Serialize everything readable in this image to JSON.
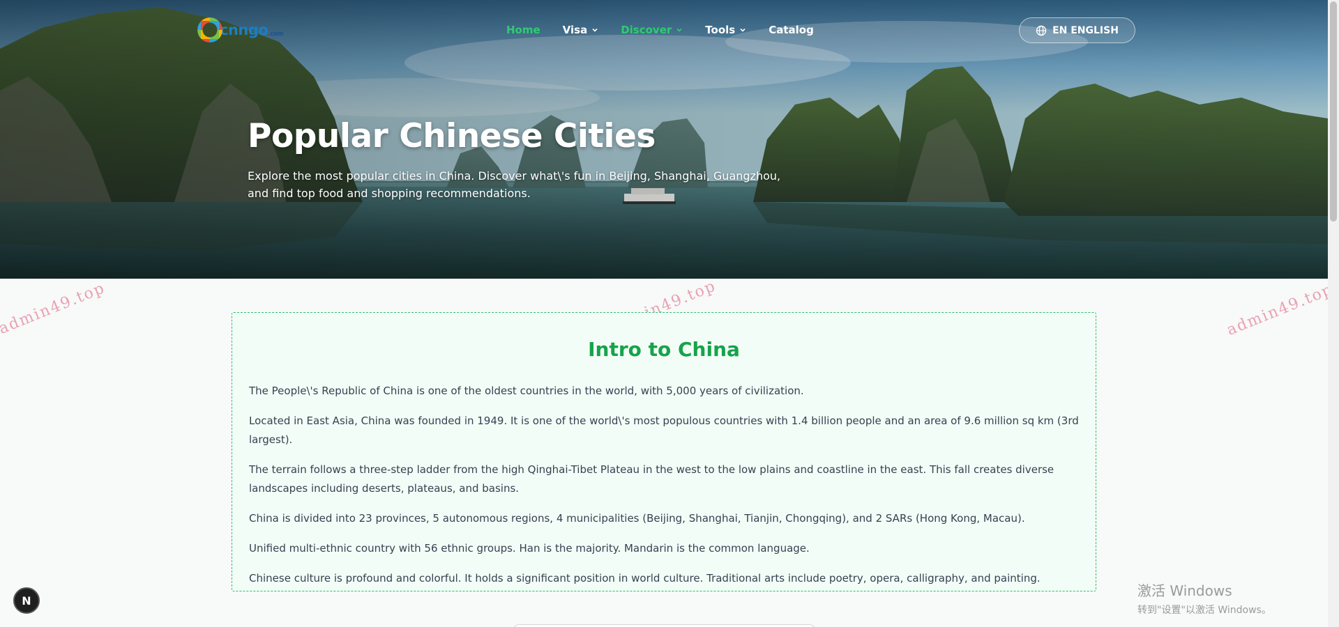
{
  "brand": {
    "logo_main": "cnngo",
    "logo_domain": ".com"
  },
  "nav": {
    "items": [
      {
        "label": "Home",
        "active": true,
        "dropdown": false
      },
      {
        "label": "Visa",
        "active": false,
        "dropdown": true
      },
      {
        "label": "Discover",
        "active": true,
        "dropdown": true
      },
      {
        "label": "Tools",
        "active": false,
        "dropdown": true
      },
      {
        "label": "Catalog",
        "active": false,
        "dropdown": false
      }
    ],
    "language_label": "EN ENGLISH"
  },
  "hero": {
    "title": "Popular Chinese Cities",
    "description": "Explore the most popular cities in China. Discover what\\'s fun in Beijing, Shanghai, Guangzhou, and find top food and shopping recommendations."
  },
  "intro": {
    "title": "Intro to China",
    "paragraphs": [
      "The People\\'s Republic of China is one of the oldest countries in the world, with 5,000 years of civilization.",
      "Located in East Asia, China was founded in 1949. It is one of the world\\'s most populous countries with 1.4 billion people and an area of 9.6 million sq km (3rd largest).",
      "The terrain follows a three-step ladder from the high Qinghai-Tibet Plateau in the west to the low plains and coastline in the east. This fall creates diverse landscapes including deserts, plateaus, and basins.",
      "China is divided into 23 provinces, 5 autonomous regions, 4 municipalities (Beijing, Shanghai, Tianjin, Chongqing), and 2 SARs (Hong Kong, Macau).",
      "Unified multi-ethnic country with 56 ethnic groups. Han is the majority. Mandarin is the common language.",
      "Chinese culture is profound and colorful. It holds a significant position in world culture. Traditional arts include poetry, opera, calligraphy, and painting."
    ]
  },
  "watermark": "admin49.top",
  "dev_badge": "N",
  "windows_activation": {
    "line1": "激活 Windows",
    "line2": "转到\"设置\"以激活 Windows。"
  },
  "colors": {
    "accent_green": "#16a34a",
    "nav_active": "#2ecc71",
    "intro_border": "#2ebd6a",
    "intro_bg": "#f3fdf7"
  }
}
